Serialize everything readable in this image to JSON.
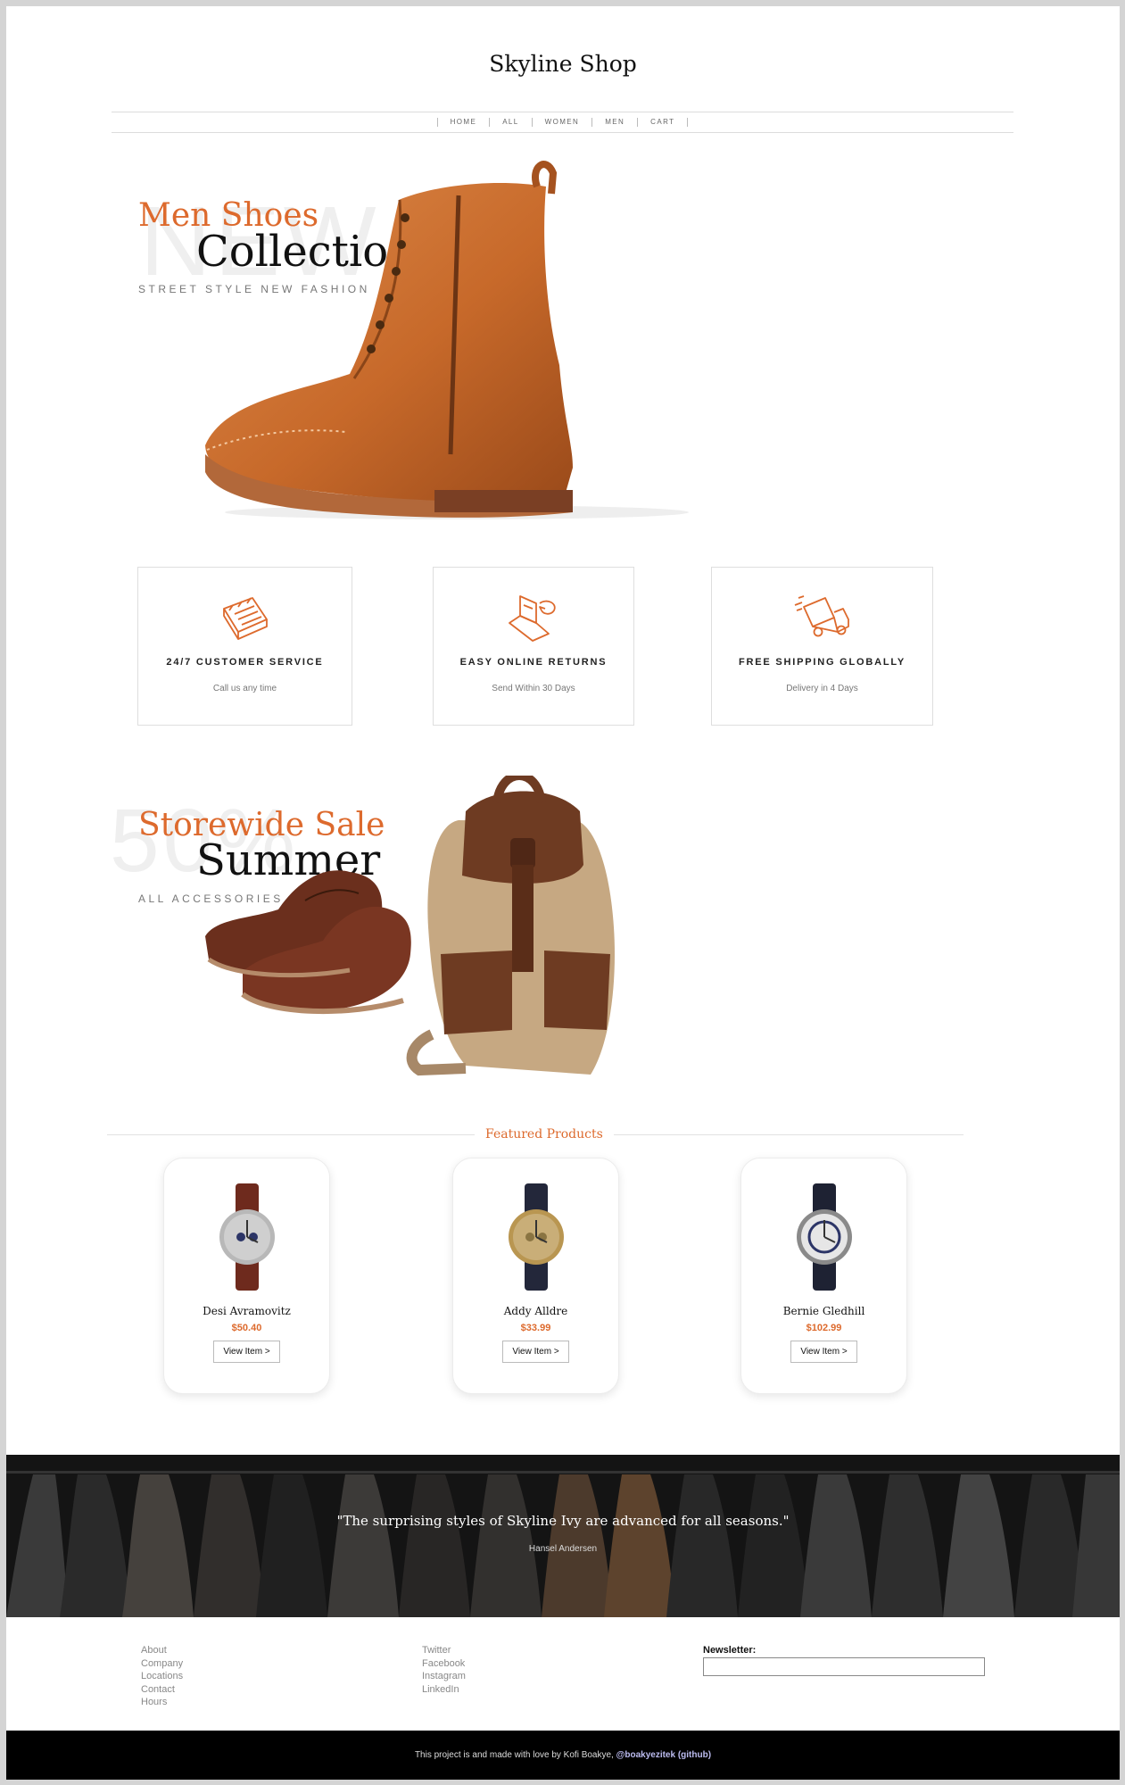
{
  "brand": "Skyline Shop",
  "nav": [
    "HOME",
    "ALL",
    "WOMEN",
    "MEN",
    "CART"
  ],
  "hero1": {
    "subtitle": "Men Shoes",
    "title": "Collection",
    "tagline": "STREET STYLE NEW FASHION",
    "bg_word": "NEW"
  },
  "features": [
    {
      "icon": "calendar-icon",
      "title": "24/7 CUSTOMER SERVICE",
      "subtitle": "Call us any time"
    },
    {
      "icon": "laptop-returns-icon",
      "title": "EASY ONLINE RETURNS",
      "subtitle": "Send Within 30 Days"
    },
    {
      "icon": "delivery-truck-icon",
      "title": "FREE SHIPPING GLOBALLY",
      "subtitle": "Delivery in 4 Days"
    }
  ],
  "hero2": {
    "subtitle": "Storewide Sale",
    "title": "Summer",
    "tagline": "ALL ACCESSORIES",
    "bg_word": "50%"
  },
  "featured": {
    "title": "Featured Products",
    "products": [
      {
        "name": "Desi Avramovitz",
        "price": "$50.40",
        "button": "View Item >",
        "strap_color": "#6e2a1d",
        "dial_color": "#cfcfcf"
      },
      {
        "name": "Addy Alldre",
        "price": "$33.99",
        "button": "View Item >",
        "strap_color": "#23273a",
        "dial_color": "#c9ae78"
      },
      {
        "name": "Bernie Gledhill",
        "price": "$102.99",
        "button": "View Item >",
        "strap_color": "#1e2233",
        "dial_color": "#e6e6e6"
      }
    ]
  },
  "testimonial": {
    "quote": "\"The surprising styles of Skyline Ivy are advanced for all seasons.\"",
    "author": "Hansel Andersen"
  },
  "footer": {
    "col1": [
      "About",
      "Company",
      "Locations",
      "Contact",
      "Hours"
    ],
    "col2": [
      "Twitter",
      "Facebook",
      "Instagram",
      "LinkedIn"
    ],
    "newsletter_label": "Newsletter:",
    "newsletter_value": ""
  },
  "bottom": {
    "text": "This project is and made with love by Kofi Boakye, ",
    "link": "@boakyezitek (github)"
  },
  "colors": {
    "accent": "#dd6a2d",
    "dark": "#111111"
  }
}
